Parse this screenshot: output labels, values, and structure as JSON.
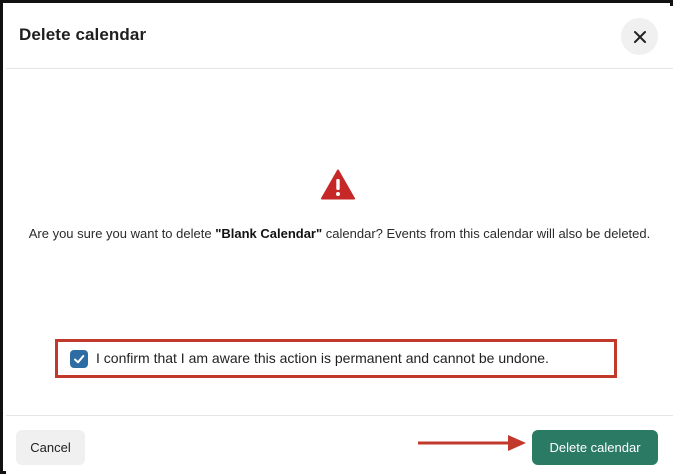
{
  "dialog": {
    "title": "Delete calendar",
    "close_icon": "close-icon",
    "warning_icon": "warning-triangle-icon",
    "message": {
      "prefix": "Are you sure you want to delete ",
      "calendar_name": "\"Blank Calendar\"",
      "suffix": " calendar? Events from this calendar will also be deleted."
    },
    "confirm": {
      "checked": true,
      "label": "I confirm that I am aware this action is permanent and cannot be undone."
    },
    "buttons": {
      "cancel": "Cancel",
      "delete": "Delete calendar"
    }
  },
  "colors": {
    "highlight_border": "#c0392b",
    "annotation_arrow": "#c0392b",
    "warning_icon": "#c62828",
    "delete_button": "#2a7a64",
    "checkbox": "#2e6da4"
  }
}
